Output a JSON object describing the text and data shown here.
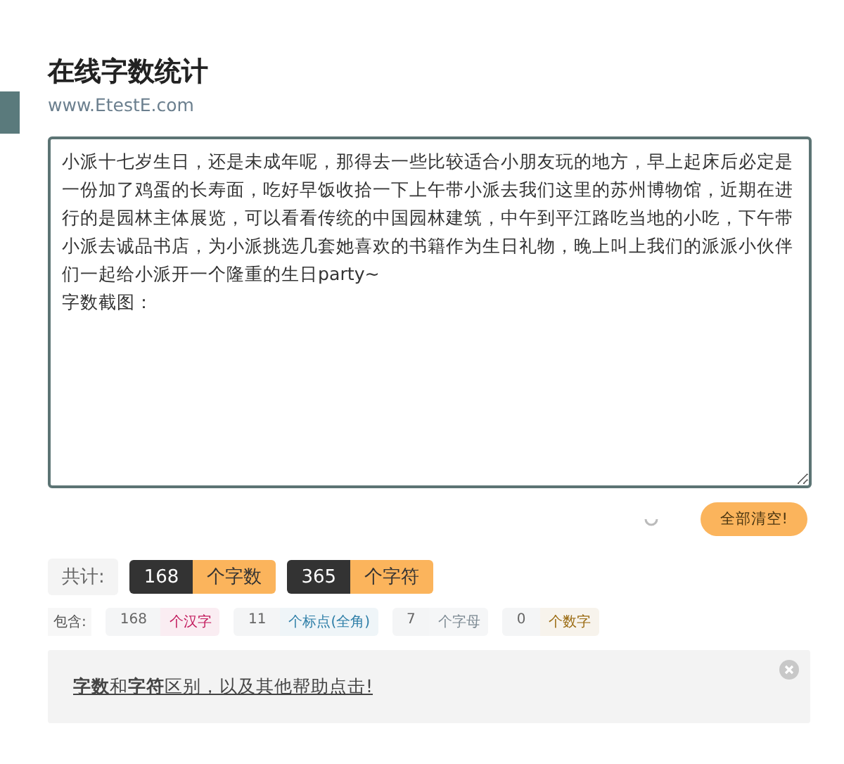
{
  "header": {
    "title": "在线字数统计",
    "subtitle": "www.EtestE.com"
  },
  "editor": {
    "value": "小派十七岁生日，还是未成年呢，那得去一些比较适合小朋友玩的地方，早上起床后必定是一份加了鸡蛋的长寿面，吃好早饭收拾一下上午带小派去我们这里的苏州博物馆，近期在进行的是园林主体展览，可以看看传统的中国园林建筑，中午到平江路吃当地的小吃，下午带小派去诚品书店，为小派挑选几套她喜欢的书籍作为生日礼物，晚上叫上我们的派派小伙伴们一起给小派开一个隆重的生日party~\n字数截图："
  },
  "clear_button": "全部清空!",
  "totals": {
    "label": "共计:",
    "items": [
      {
        "number": "168",
        "unit": "个字数"
      },
      {
        "number": "365",
        "unit": "个字符"
      }
    ]
  },
  "breakdown": {
    "label": "包含:",
    "items": [
      {
        "number": "168",
        "unit": "个汉字",
        "color": "#c2185b"
      },
      {
        "number": "11",
        "unit": "个标点(全角)",
        "color": "#2f7fa8"
      },
      {
        "number": "7",
        "unit": "个字母",
        "color": "#7d8a93"
      },
      {
        "number": "0",
        "unit": "个数字",
        "color": "#9a6a10"
      }
    ]
  },
  "help": {
    "link": "**字数**和**字符**区别，以及其他帮助点击!"
  }
}
